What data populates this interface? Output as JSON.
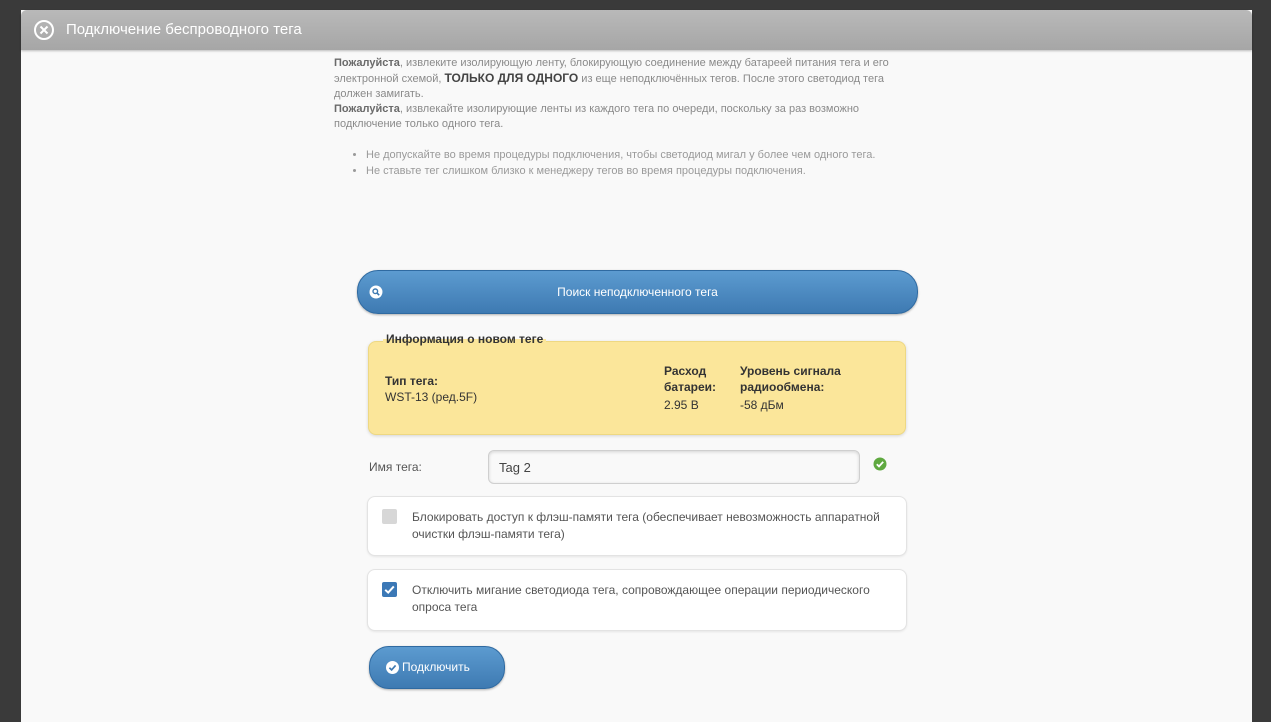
{
  "dialog": {
    "title": "Подключение беспроводного тега"
  },
  "intro": {
    "please1": "Пожалуйста",
    "part1": ", извлеките изолирующую ленту, блокирующую соединение между батареей питания тега и его электронной схемой, ",
    "emphasis": "ТОЛЬКО ДЛЯ ОДНОГО",
    "part2": " из еще неподключённых тегов. После этого светодиод тега должен замигать.",
    "please2": "Пожалуйста",
    "part3": ", извлекайте изолирующие ленты из каждого тега по очереди, поскольку за раз возможно подключение только одного тега."
  },
  "notes": [
    "Не допускайте во время процедуры подключения, чтобы светодиод мигал у более чем одного тега.",
    "Не ставьте тег слишком близко к менеджеру тегов во время процедуры подключения."
  ],
  "search": {
    "label": "Поиск неподключенного тега"
  },
  "info": {
    "legend": "Информация о новом теге",
    "type_label": "Тип тега:",
    "type_value": "WST-13 (ред.5F)",
    "battery_label_1": "Расход",
    "battery_label_2": "батареи:",
    "battery_value": "2.95 В",
    "signal_label_1": "Уровень сигнала",
    "signal_label_2": "радиообмена:",
    "signal_value": "-58 дБм"
  },
  "name": {
    "label": "Имя тега:",
    "value": "Tag 2"
  },
  "options": {
    "lock_flash": {
      "checked": false,
      "text": "Блокировать доступ к флэш-памяти тега (обеспечивает невозможность аппаратной очистки флэш-памяти тега)"
    },
    "disable_led": {
      "checked": true,
      "text": "Отключить мигание светодиода тега, сопровождающее операции периодического опроса тега"
    }
  },
  "connect": {
    "label": "Подключить"
  },
  "colors": {
    "accent": "#3e7ab2",
    "info_bg": "#fbe69a",
    "ok": "#5fa940"
  },
  "icons": [
    "close-icon",
    "search-icon",
    "ok-icon",
    "check-icon"
  ]
}
